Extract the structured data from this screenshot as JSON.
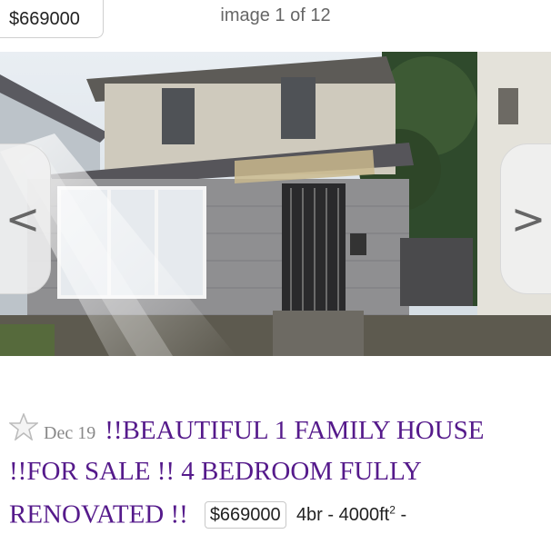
{
  "gallery": {
    "price": "$669000",
    "counter": "image 1 of 12",
    "prev_arrow": "<",
    "next_arrow": ">"
  },
  "listing": {
    "date": "Dec 19",
    "title": "!!BEAUTIFUL 1 FAMILY HOUSE !!FOR SALE !! 4 BEDROOM FULLY RENOVATED !!",
    "price": "$669000",
    "bedrooms": "4br",
    "area_prefix": "- 4000ft",
    "area_sup": "2",
    "area_suffix": "-"
  },
  "colors": {
    "title": "#551a8b",
    "date": "#888888",
    "star": "#bbbbbb"
  }
}
